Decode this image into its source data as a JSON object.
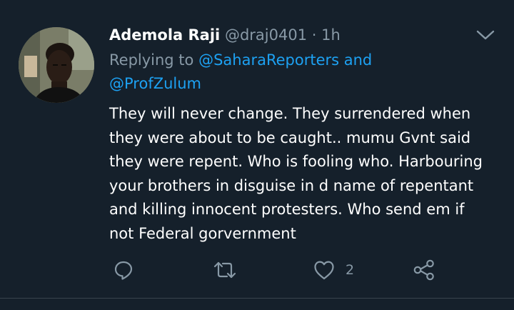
{
  "tweet": {
    "author_name": "Ademola Raji",
    "author_handle": "@draj0401",
    "separator": " · ",
    "time_ago": "1h",
    "replying_prefix": "Replying to ",
    "mention_1": "@SaharaReporters",
    "mention_joiner": " and",
    "mention_2": "@ProfZulum",
    "text": "They will never change. They surrendered when\nthey were about to be caught.. mumu Gvnt said\nthey were repent. Who is fooling who. Harbouring\nyour brothers in disguise in d name of repentant\nand killing innocent protesters. Who send em if\nnot Federal gorvernment",
    "like_count": "2"
  },
  "icons": {
    "menu": "chevron-down-icon",
    "reply": "reply-icon",
    "retweet": "retweet-icon",
    "like": "heart-icon",
    "share": "share-icon"
  },
  "colors": {
    "background": "#15202b",
    "primary_text": "#ffffff",
    "secondary_text": "#8899a6",
    "link": "#1da1f2",
    "divider": "#38444d"
  }
}
